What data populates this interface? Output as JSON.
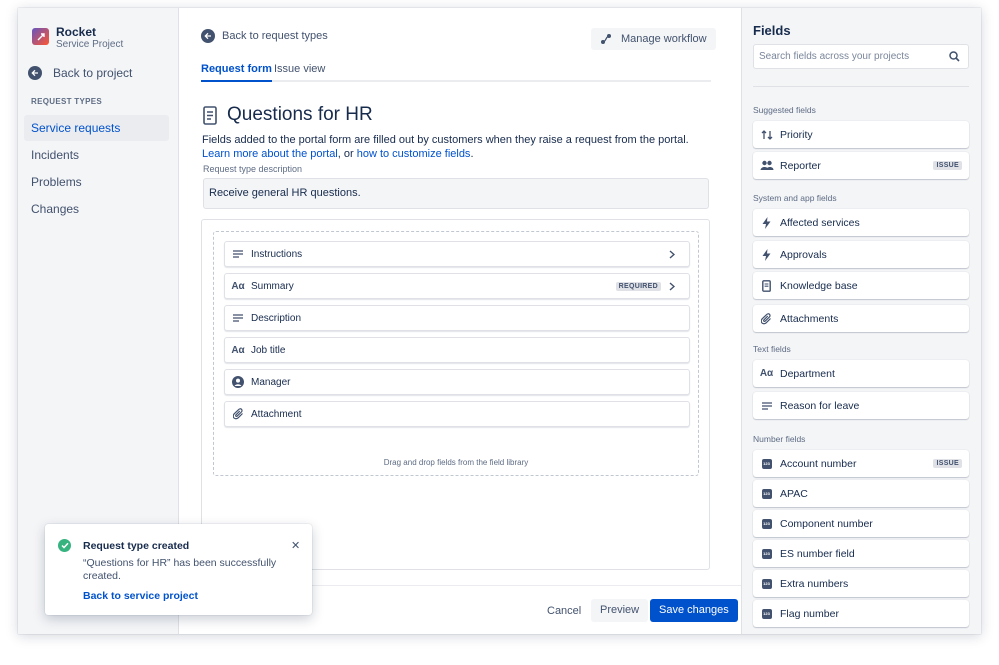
{
  "project": {
    "name": "Rocket",
    "type": "Service Project"
  },
  "sidebar": {
    "back_label": "Back to project",
    "section_label": "REQUEST TYPES",
    "items": [
      {
        "label": "Service requests",
        "active": true
      },
      {
        "label": "Incidents"
      },
      {
        "label": "Problems"
      },
      {
        "label": "Changes"
      }
    ]
  },
  "main": {
    "back_label": "Back to request types",
    "manage_workflow_label": "Manage workflow",
    "tabs": [
      {
        "label": "Request form",
        "active": true
      },
      {
        "label": "Issue view"
      }
    ],
    "title": "Questions for HR",
    "description_text": "Fields added to the portal form are filled out by customers when they raise a request from the portal. ",
    "learn_more_link": "Learn more about the portal",
    "or_text": ", or ",
    "customize_link": "how to customize fields",
    "period": ".",
    "request_type_description_label": "Request type description",
    "request_type_description_value": "Receive general HR questions.",
    "form_fields": [
      {
        "label": "Instructions",
        "icon": "lines-icon",
        "chevron": true
      },
      {
        "label": "Summary",
        "icon": "text-aa-icon",
        "badge": "REQUIRED",
        "chevron": true
      },
      {
        "label": "Description",
        "icon": "lines-icon"
      },
      {
        "label": "Job title",
        "icon": "text-aa-icon"
      },
      {
        "label": "Manager",
        "icon": "user-icon"
      },
      {
        "label": "Attachment",
        "icon": "paperclip-icon"
      }
    ],
    "drop_hint": "Drag and drop fields from the field library",
    "cancel_label": "Cancel",
    "preview_label": "Preview",
    "save_label": "Save changes"
  },
  "fields_panel": {
    "title": "Fields",
    "search_placeholder": "Search fields across your projects",
    "groups": [
      {
        "label": "Suggested fields",
        "items": [
          {
            "label": "Priority",
            "icon": "priority-icon"
          },
          {
            "label": "Reporter",
            "icon": "people-icon",
            "badge": "ISSUE"
          }
        ]
      },
      {
        "label": "System and app fields",
        "items": [
          {
            "label": "Affected services",
            "icon": "lightning-icon"
          },
          {
            "label": "Approvals",
            "icon": "lightning-icon"
          },
          {
            "label": "Knowledge base",
            "icon": "page-icon"
          },
          {
            "label": "Attachments",
            "icon": "paperclip-icon"
          }
        ]
      },
      {
        "label": "Text fields",
        "items": [
          {
            "label": "Department",
            "icon": "text-aa-icon"
          },
          {
            "label": "Reason for leave",
            "icon": "lines-icon"
          }
        ]
      },
      {
        "label": "Number fields",
        "items": [
          {
            "label": "Account number",
            "icon": "number-icon",
            "badge": "ISSUE"
          },
          {
            "label": "APAC",
            "icon": "number-icon"
          },
          {
            "label": "Component number",
            "icon": "number-icon"
          },
          {
            "label": "ES number field",
            "icon": "number-icon"
          },
          {
            "label": "Extra numbers",
            "icon": "number-icon"
          },
          {
            "label": "Flag number",
            "icon": "number-icon"
          }
        ]
      }
    ]
  },
  "toast": {
    "title": "Request type created",
    "body": "“Questions for HR” has been successfully created.",
    "link": "Back to service project",
    "close_glyph": "✕"
  },
  "icon_glyphs": {
    "text_aa": "Aα",
    "number": "123"
  },
  "colors": {
    "accent": "#0052cc",
    "success": "#36b37e"
  }
}
